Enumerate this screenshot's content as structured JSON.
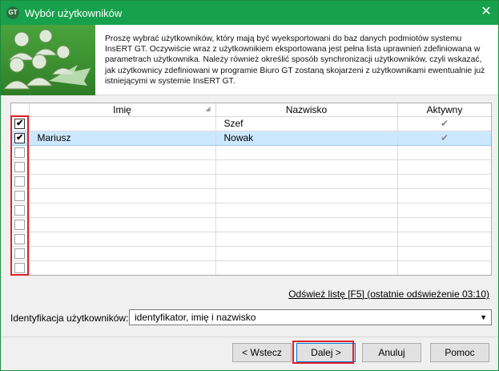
{
  "window": {
    "title": "Wybór użytkowników",
    "app_icon": "GT",
    "close_glyph": "✕"
  },
  "header": {
    "intro_text": "Proszę wybrać użytkowników, który mają być wyeksportowani do baz danych podmiotów systemu InsERT GT. Oczywiście wraz z użytkownikiem eksportowana jest pełna lista uprawnień zdefiniowana w parametrach użytkownika. Należy również określić sposób synchronizacji użytkowników, czyli wskazać, jak użytkownicy zdefiniowani w programie Biuro GT zostaną skojarzeni z użytkownikami ewentualnie już istniejącymi w systemie InsERT GT."
  },
  "grid": {
    "columns": [
      "",
      "Imię",
      "Nazwisko",
      "Aktywny"
    ],
    "rows": [
      {
        "checked": true,
        "first": "",
        "last": "Szef",
        "active": true,
        "selected": false
      },
      {
        "checked": true,
        "first": "Mariusz",
        "last": "Nowak",
        "active": true,
        "selected": true
      },
      {
        "checked": false,
        "first": "",
        "last": "",
        "active": false,
        "selected": false
      },
      {
        "checked": false,
        "first": "",
        "last": "",
        "active": false,
        "selected": false
      },
      {
        "checked": false,
        "first": "",
        "last": "",
        "active": false,
        "selected": false
      },
      {
        "checked": false,
        "first": "",
        "last": "",
        "active": false,
        "selected": false
      },
      {
        "checked": false,
        "first": "",
        "last": "",
        "active": false,
        "selected": false
      },
      {
        "checked": false,
        "first": "",
        "last": "",
        "active": false,
        "selected": false
      },
      {
        "checked": false,
        "first": "",
        "last": "",
        "active": false,
        "selected": false
      },
      {
        "checked": false,
        "first": "",
        "last": "",
        "active": false,
        "selected": false
      },
      {
        "checked": false,
        "first": "",
        "last": "",
        "active": false,
        "selected": false
      }
    ],
    "checkmark_glyph": "✔"
  },
  "refresh": {
    "link_text": "Odśwież listę [F5]",
    "suffix_text": " (ostatnie odświeżenie 03:10)"
  },
  "identification": {
    "label": "Identyfikacja użytkowników:",
    "selected_value": "identyfikator, imię i nazwisko"
  },
  "buttons": {
    "back": "< Wstecz",
    "next": "Dalej >",
    "cancel": "Anuluj",
    "help": "Pomoc"
  },
  "colors": {
    "titlebar": "#18a14c",
    "highlight": "#e0202a",
    "selected_row": "#cce8ff"
  }
}
